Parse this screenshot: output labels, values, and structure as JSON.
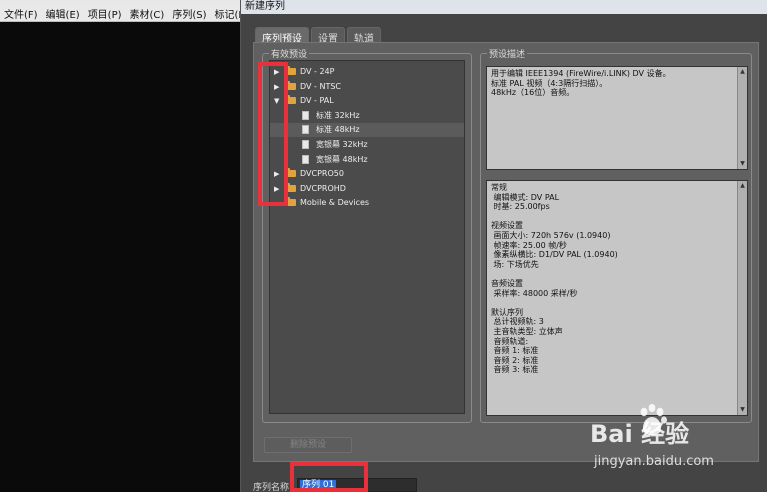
{
  "menubar": {
    "items": [
      "文件(F)",
      "编辑(E)",
      "项目(P)",
      "素材(C)",
      "序列(S)",
      "标记(M)"
    ]
  },
  "dialog": {
    "title": "新建序列",
    "tabs": [
      "序列预设",
      "设置",
      "轨道"
    ],
    "active_tab": 0,
    "presets_group_label": "有效预设",
    "description_group_label": "预设描述",
    "delete_button": "删除预设",
    "sequence_name_label": "序列名称:",
    "sequence_name_value": "序列 01"
  },
  "tree": [
    {
      "label": "DV - 24P",
      "type": "folder",
      "depth": 0,
      "expanded": false
    },
    {
      "label": "DV - NTSC",
      "type": "folder",
      "depth": 0,
      "expanded": false
    },
    {
      "label": "DV - PAL",
      "type": "folder",
      "depth": 0,
      "expanded": true
    },
    {
      "label": "标准 32kHz",
      "type": "file",
      "depth": 1
    },
    {
      "label": "标准 48kHz",
      "type": "file",
      "depth": 1,
      "selected": true
    },
    {
      "label": "宽银幕 32kHz",
      "type": "file",
      "depth": 1
    },
    {
      "label": "宽银幕 48kHz",
      "type": "file",
      "depth": 1
    },
    {
      "label": "DVCPRO50",
      "type": "folder",
      "depth": 0,
      "expanded": false
    },
    {
      "label": "DVCPROHD",
      "type": "folder",
      "depth": 0,
      "expanded": false
    },
    {
      "label": "Mobile & Devices",
      "type": "folder",
      "depth": 0,
      "expanded": false,
      "no_arrow": true
    }
  ],
  "description": "用于编辑 IEEE1394 (FireWire/i.LINK) DV 设备。\n标准 PAL 视频（4:3隔行扫描）。\n48kHz（16位）音频。",
  "details": "常规\n 编辑模式: DV PAL\n 时基: 25.00fps\n\n视频设置\n 画面大小: 720h 576v (1.0940)\n 帧速率: 25.00 帧/秒\n 像素纵横比: D1/DV PAL (1.0940)\n 场: 下场优先\n\n音频设置\n 采样率: 48000 采样/秒\n\n默认序列\n 总计视频轨: 3\n 主音轨类型: 立体声\n 音频轨道:\n 音频 1: 标准\n 音频 2: 标准\n 音频 3: 标准",
  "watermark": {
    "main": "Bai  经验",
    "sub": "jingyan.baidu.com"
  },
  "colors": {
    "highlight": "#e8313a",
    "folder": "#e2a23d",
    "selection": "#2f6fd6"
  }
}
